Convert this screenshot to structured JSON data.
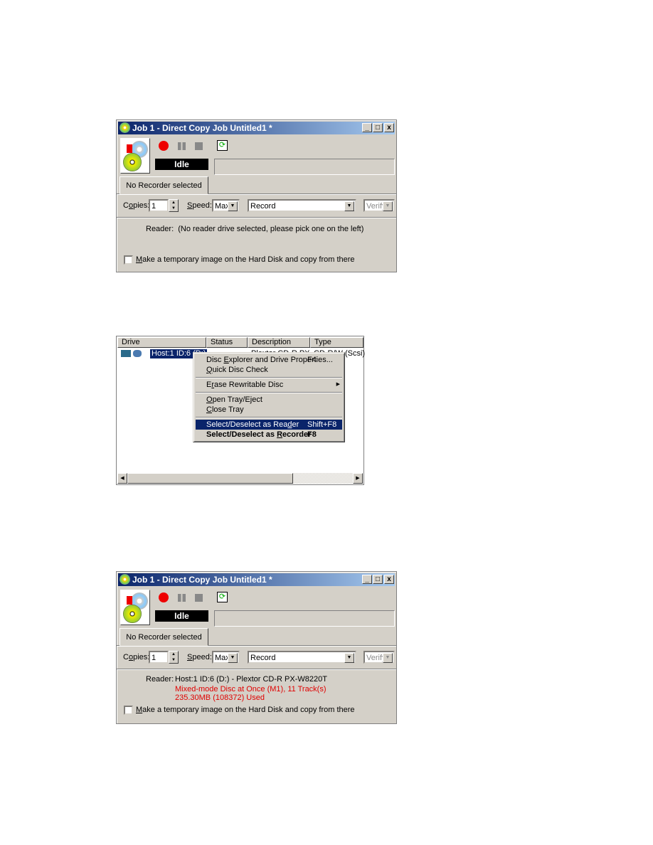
{
  "window1": {
    "title": "Job 1 - Direct Copy Job Untitled1 *",
    "status": "Idle",
    "tab": "No Recorder selected",
    "copies_label_pre": "C",
    "copies_label_u": "o",
    "copies_label_rest": "pies:",
    "copies_value": "1",
    "speed_label_u": "S",
    "speed_label_rest": "peed:",
    "speed_value": "Max",
    "mode_value": "Record",
    "verify_value": "Verify",
    "reader_label": "Reader:",
    "reader_value": "(No reader drive selected, please pick one on the left)",
    "checkbox_u": "M",
    "checkbox_rest": "ake a temporary image on the Hard Disk and copy from there",
    "checkbox_checked": false
  },
  "drive_list": {
    "columns": [
      "Drive",
      "Status",
      "Description",
      "Type"
    ],
    "rows": [
      {
        "drive": "Host:1 ID:6 (D:)",
        "status": "",
        "description": "Plextor CD-R PX",
        "type": "CD-R/W (Scsi)"
      }
    ],
    "context_menu": [
      {
        "pre": "Disc ",
        "u": "E",
        "rest": "xplorer and Drive Properties...",
        "shortcut": "F4"
      },
      {
        "pre": "",
        "u": "Q",
        "rest": "uick Disc Check",
        "shortcut": ""
      },
      {
        "pre": "E",
        "u": "r",
        "rest": "ase Rewritable Disc",
        "shortcut": "",
        "submenu": true
      },
      {
        "pre": "",
        "u": "O",
        "rest": "pen Tray/Eject",
        "shortcut": ""
      },
      {
        "pre": "",
        "u": "C",
        "rest": "lose Tray",
        "shortcut": ""
      },
      {
        "pre": "Select/Deselect as Rea",
        "u": "d",
        "rest": "er",
        "shortcut": "Shift+F8",
        "selected": true
      },
      {
        "pre": "Select/Deselect as ",
        "u": "R",
        "rest": "ecorder",
        "shortcut": "F8",
        "bold": true
      }
    ]
  },
  "window2": {
    "title": "Job 1 - Direct Copy Job Untitled1 *",
    "status": "Idle",
    "tab": "No Recorder selected",
    "copies_label_pre": "C",
    "copies_label_u": "o",
    "copies_label_rest": "pies:",
    "copies_value": "1",
    "speed_label_u": "S",
    "speed_label_rest": "peed:",
    "speed_value": "Max",
    "mode_value": "Record",
    "verify_value": "Verify",
    "reader_label": "Reader:",
    "reader_value": "Host:1 ID:6 (D:) - Plextor CD-R PX-W8220T",
    "disc_info_1": "Mixed-mode Disc at Once (M1), 11 Track(s)",
    "disc_info_2": "235.30MB (108372) Used",
    "checkbox_u": "M",
    "checkbox_rest": "ake a temporary image on the Hard Disk and copy from there",
    "checkbox_checked": false
  },
  "colors": {
    "titlebar": "#0a246a",
    "record": "#e00000",
    "disc_info": "#e00000",
    "menu_highlight": "#0a246a"
  }
}
